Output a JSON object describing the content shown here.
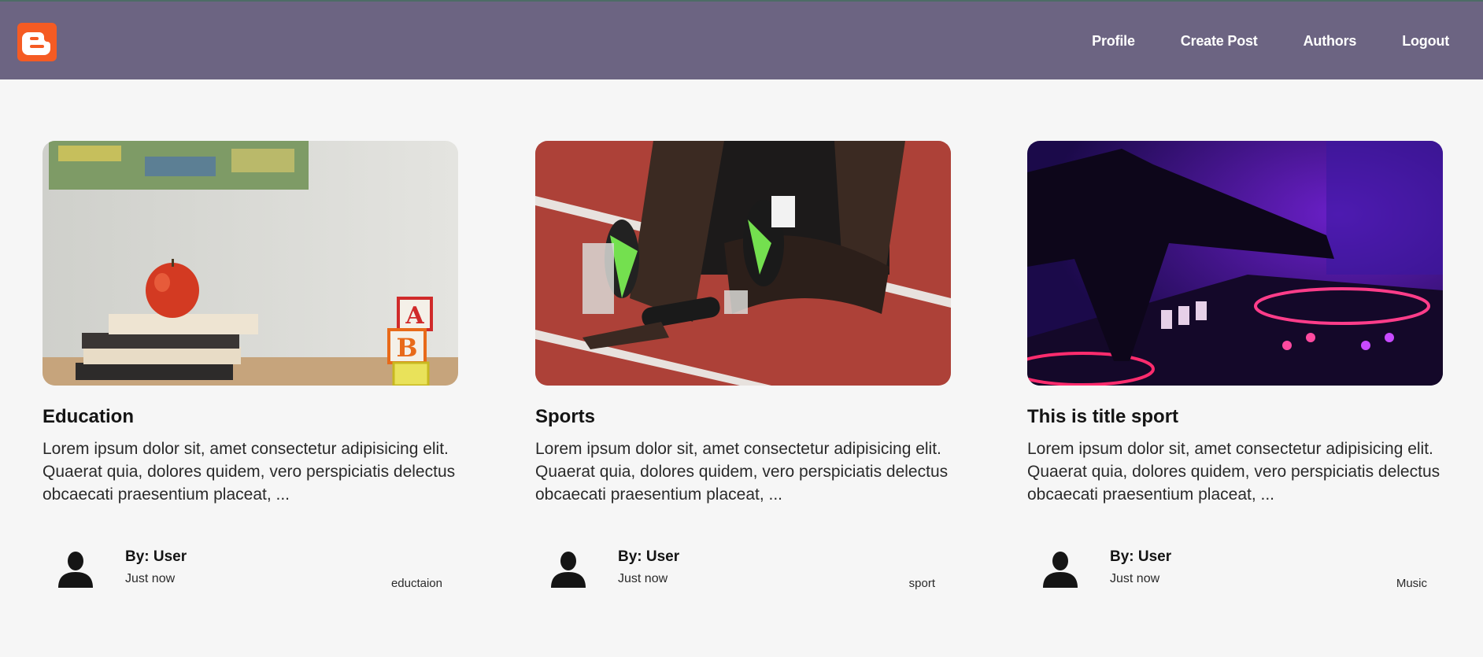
{
  "nav": {
    "logo": "blogger-logo-icon",
    "links": [
      "Profile",
      "Create Post",
      "Authors",
      "Logout"
    ]
  },
  "posts": [
    {
      "image": "education-apple-books-blocks-image",
      "title": "Education",
      "excerpt": "Lorem ipsum dolor sit, amet consectetur adipisicing elit. Quaerat quia, dolores quidem, vero perspiciatis delectus obcaecati praesentium placeat, ...",
      "author": "By: User",
      "time": "Just now",
      "tag": "eductaion"
    },
    {
      "image": "sprinter-track-start-image",
      "title": "Sports",
      "excerpt": "Lorem ipsum dolor sit, amet consectetur adipisicing elit. Quaerat quia, dolores quidem, vero perspiciatis delectus obcaecati praesentium placeat, ...",
      "author": "By: User",
      "time": "Just now",
      "tag": "sport"
    },
    {
      "image": "dj-mixer-purple-image",
      "title": "This is title sport",
      "excerpt": "Lorem ipsum dolor sit, amet consectetur adipisicing elit. Quaerat quia, dolores quidem, vero perspiciatis delectus obcaecati praesentium placeat, ...",
      "author": "By: User",
      "time": "Just now",
      "tag": "Music"
    }
  ],
  "colors": {
    "navbar": "#6c6482",
    "logo": "#f55b23",
    "background": "#f6f6f6"
  }
}
